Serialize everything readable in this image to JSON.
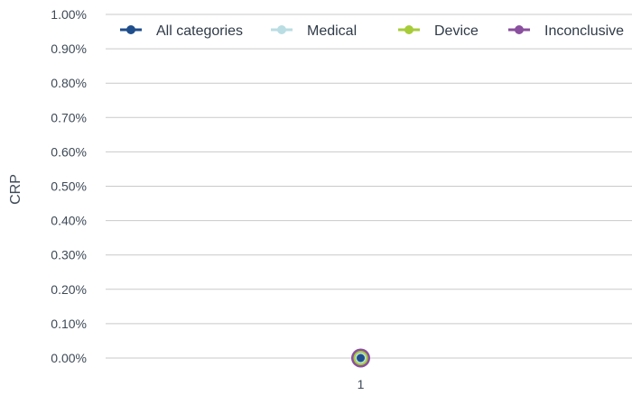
{
  "chart_data": {
    "type": "line",
    "categories": [
      "1"
    ],
    "series": [
      {
        "name": "All categories",
        "values": [
          0.0
        ],
        "color": "#1f4e8c"
      },
      {
        "name": "Medical",
        "values": [
          0.0
        ],
        "color": "#b9dde3"
      },
      {
        "name": "Device",
        "values": [
          0.0
        ],
        "color": "#a7cc3a"
      },
      {
        "name": "Inconclusive",
        "values": [
          0.0
        ],
        "color": "#8a4f9e"
      }
    ],
    "y_ticks": [
      "0.00%",
      "0.10%",
      "0.20%",
      "0.30%",
      "0.40%",
      "0.50%",
      "0.60%",
      "0.70%",
      "0.80%",
      "0.90%",
      "1.00%"
    ],
    "ylabel": "CRP",
    "xlabel": "",
    "title": "",
    "ylim": [
      0,
      1.0
    ],
    "y_unit": "%",
    "grid": true,
    "legend_position": "top"
  }
}
